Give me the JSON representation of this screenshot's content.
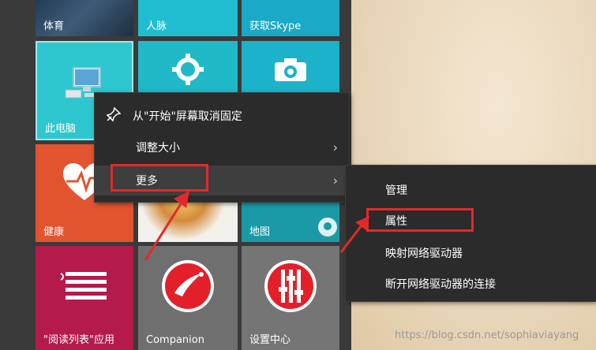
{
  "tiles": {
    "sports": {
      "label": "体育"
    },
    "people": {
      "label": "人脉"
    },
    "skype": {
      "label": "获取Skype"
    },
    "pc": {
      "label": "此电脑"
    },
    "health": {
      "label": "健康"
    },
    "map": {
      "label": "地图"
    },
    "reading": {
      "label": "\"阅读列表\"应用"
    },
    "companion": {
      "label": "Companion"
    },
    "settings_center": {
      "label": "设置中心"
    }
  },
  "context_menu": {
    "items": [
      {
        "label": "从\"开始\"屏幕取消固定",
        "icon": "unpin-icon"
      },
      {
        "label": "调整大小",
        "chevron": "›"
      },
      {
        "label": "更多",
        "chevron": "›"
      }
    ]
  },
  "submenu": {
    "items": [
      {
        "label": "管理"
      },
      {
        "label": "属性"
      },
      {
        "label": "映射网络驱动器"
      },
      {
        "label": "断开网络驱动器的连接"
      }
    ]
  },
  "watermark": "https://blog.csdn.net/sophiaviayang",
  "colors": {
    "highlight": "#e02a2a",
    "menu_bg": "#2b2b2b",
    "tile_teal": "#2fc7cf"
  }
}
